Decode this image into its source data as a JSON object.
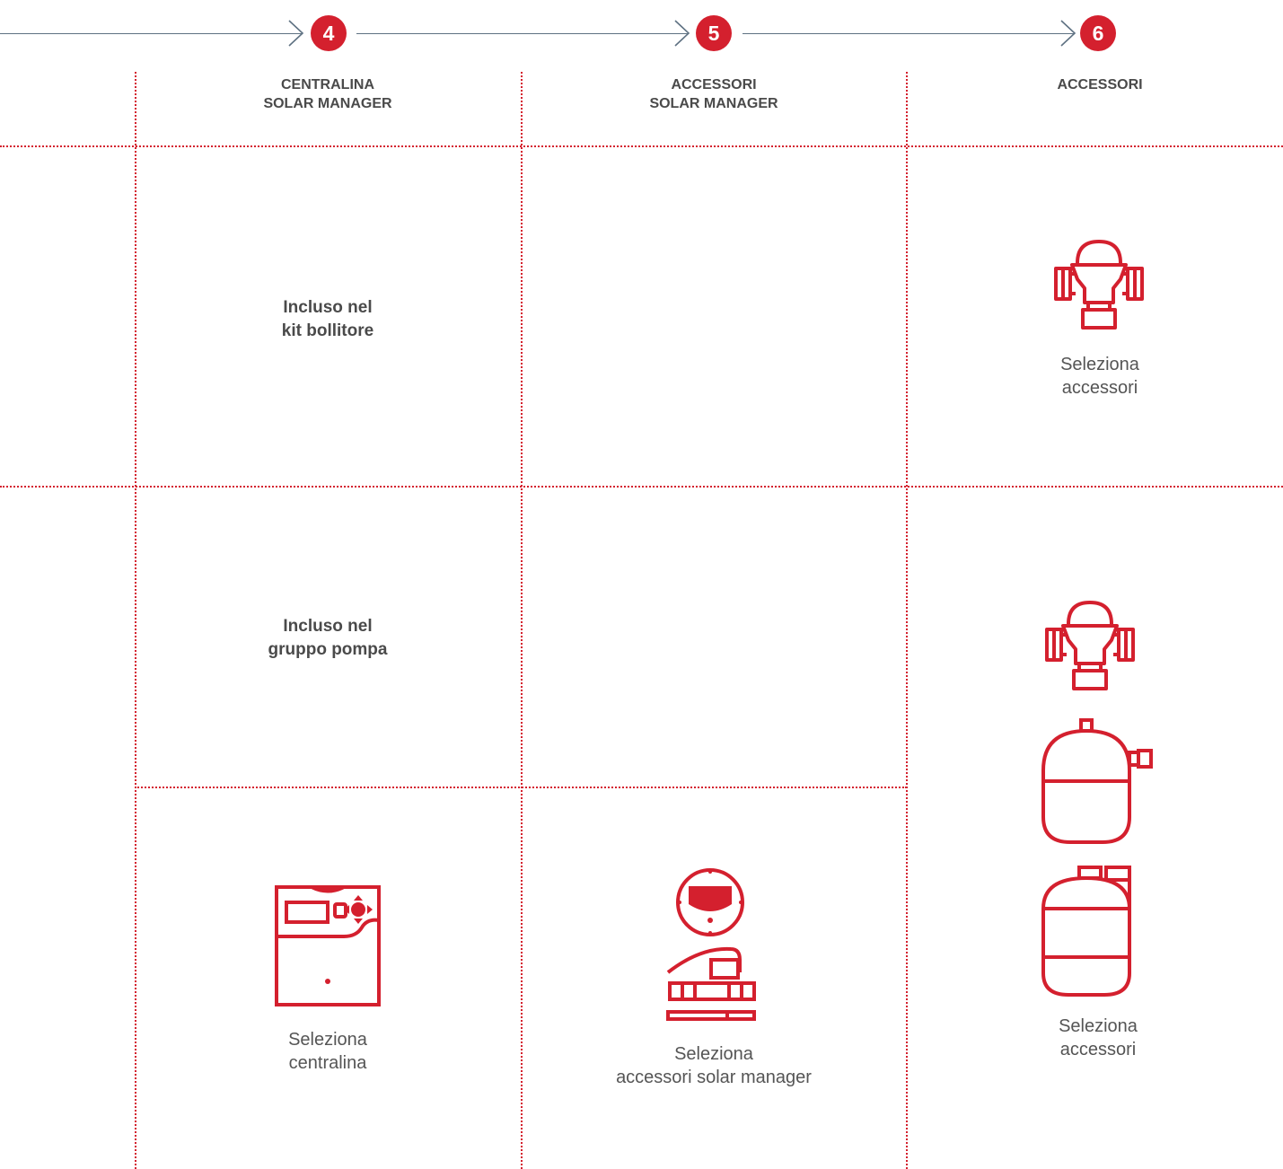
{
  "steps": [
    {
      "number": "4",
      "label": "CENTRALINA\nSOLAR MANAGER"
    },
    {
      "number": "5",
      "label": "ACCESSORI\nSOLAR MANAGER"
    },
    {
      "number": "6",
      "label": "ACCESSORI"
    }
  ],
  "rows": {
    "row1": {
      "col4_note": "Incluso nel\nkit bollitore",
      "col6_link": "Seleziona\naccessori"
    },
    "row2": {
      "col4_note": "Incluso nel\ngruppo pompa",
      "col4_link": "Seleziona\ncentralina",
      "col5_link": "Seleziona\naccessori solar manager",
      "col6_link": "Seleziona\naccessori"
    }
  },
  "icons": {
    "valve": "mixing-valve-icon",
    "expansion_vessel": "expansion-vessel-icon",
    "tank": "tank-icon",
    "controller": "controller-icon",
    "solar_accessories": "solar-manager-accessories-icon"
  },
  "colors": {
    "accent": "#d4202e",
    "step_line": "#5e7182",
    "text": "#4a4a4a"
  }
}
